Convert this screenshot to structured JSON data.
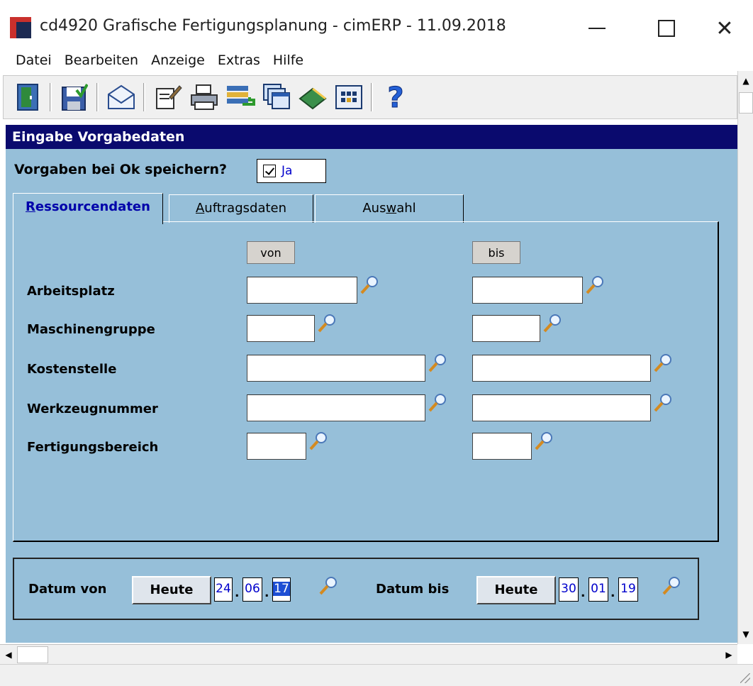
{
  "window": {
    "title": "cd4920 Grafische Fertigungsplanung - cimERP - 11.09.2018",
    "close_glyph": "✕"
  },
  "menu": [
    "Datei",
    "Bearbeiten",
    "Anzeige",
    "Extras",
    "Hilfe"
  ],
  "toolbar": {
    "icons": [
      "exit-door-icon",
      "save-icon",
      "mail-icon",
      "edit-notes-icon",
      "print-icon",
      "export-icon",
      "windows-icon",
      "book-icon",
      "table-grid-icon",
      "help-icon"
    ]
  },
  "section": {
    "title": "Eingabe Vorgabedaten"
  },
  "save_prompt": {
    "label": "Vorgaben bei Ok speichern?",
    "value": "Ja",
    "checked": true
  },
  "tabs": {
    "ressourcen": {
      "pre": "",
      "u": "R",
      "post": "essourcendaten"
    },
    "auftrag": {
      "pre": "",
      "u": "A",
      "post": "uftragsdaten"
    },
    "auswahl": {
      "pre": "Aus",
      "u": "w",
      "post": "ahl"
    },
    "active": "Ressourcendaten"
  },
  "columns": {
    "from": "von",
    "to": "bis"
  },
  "rows": [
    {
      "label": "Arbeitsplatz",
      "from": "",
      "to": ""
    },
    {
      "label": "Maschinengruppe",
      "from": "",
      "to": ""
    },
    {
      "label": "Kostenstelle",
      "from": "",
      "to": ""
    },
    {
      "label": "Werkzeugnummer",
      "from": "",
      "to": ""
    },
    {
      "label": "Fertigungsbereich",
      "from": "",
      "to": ""
    }
  ],
  "dates": {
    "from_label": "Datum von",
    "to_label": "Datum bis",
    "today_label": "Heute",
    "from": {
      "day": "24",
      "month": "06",
      "year": "17"
    },
    "to": {
      "day": "30",
      "month": "01",
      "year": "19"
    },
    "separator": "."
  },
  "colors": {
    "panel_bg": "#96bfd9",
    "header_bg": "#0a0a6e",
    "value_text": "#0000cc"
  }
}
